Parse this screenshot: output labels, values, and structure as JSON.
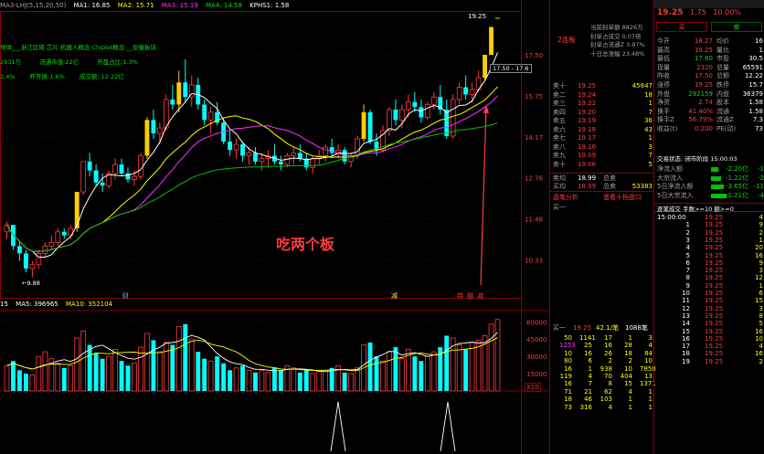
{
  "chart_header": {
    "indicator": "MA3-LHJ(5,15,20,50)",
    "ma1": "MA1: 16.85",
    "ma2": "MA2: 15.71",
    "ma3": "MA3: 15.19",
    "ma4": "MA4: 14.58",
    "kphs": "KPHS1: 1.58"
  },
  "info_lines": {
    "line1": "导体___浙江区域 芯片 机器人概念 Chiplet概念 __安徽板块",
    "line2a": "2931万",
    "line2b": "流通市值:22亿",
    "line2c": "开盘占比:1.3%",
    "line3a": "1.4%",
    "line3b": "昨开换:1.6%",
    "line3c": "成交额: 12.22亿"
  },
  "price_axis": [
    "17.50",
    "15.75",
    "14.17",
    "12.76",
    "11.48",
    "10.33"
  ],
  "top_marker": "19.25",
  "price_label_box": "17.50 - 17.6",
  "low_marker": "←9.88",
  "annotation": "吃两个板",
  "event_marks": [
    "财",
    "减",
    "持",
    "融",
    "减"
  ],
  "volume_header": {
    "vol": "15",
    "ma5": "MA5: 396965",
    "ma10": "MA10: 352104"
  },
  "volume_axis": [
    "60000",
    "45000",
    "30000",
    "15000"
  ],
  "volume_unit": "X10",
  "chart_data": {
    "type": "bar",
    "title": "",
    "xlabel": "",
    "ylabel": "",
    "ylim": [
      9.5,
      19.5
    ],
    "x": [
      0,
      1,
      2,
      3,
      4,
      5,
      6,
      7,
      8,
      9,
      10,
      11,
      12,
      13,
      14,
      15,
      16,
      17,
      18,
      19,
      20,
      21,
      22,
      23,
      24,
      25,
      26,
      27,
      28,
      29,
      30,
      31,
      32,
      33,
      34,
      35,
      36,
      37,
      38,
      39,
      40,
      41,
      42,
      43,
      44,
      45,
      46,
      47,
      48,
      49,
      50,
      51,
      52,
      53,
      54,
      55,
      56,
      57,
      58,
      59,
      60,
      61,
      62,
      63,
      64,
      65,
      66,
      67,
      68,
      69,
      70,
      71,
      72,
      73,
      74,
      75,
      76,
      77,
      78,
      79,
      80,
      81,
      82,
      83,
      84,
      85,
      86,
      87
    ],
    "candles": [
      [
        11.1,
        11.4,
        10.9,
        11.3
      ],
      [
        11.3,
        11.3,
        10.6,
        10.7
      ],
      [
        10.7,
        10.8,
        10.3,
        10.5
      ],
      [
        10.5,
        10.6,
        10.0,
        10.1
      ],
      [
        10.1,
        10.3,
        9.88,
        10.2
      ],
      [
        10.2,
        10.6,
        10.1,
        10.5
      ],
      [
        10.5,
        10.8,
        10.4,
        10.7
      ],
      [
        10.7,
        11.0,
        10.6,
        10.8
      ],
      [
        10.8,
        11.2,
        10.7,
        11.1
      ],
      [
        11.1,
        11.2,
        10.9,
        11.0
      ],
      [
        11.0,
        11.3,
        10.9,
        11.2
      ],
      [
        11.2,
        12.3,
        11.1,
        12.3
      ],
      [
        12.3,
        13.3,
        12.2,
        13.3
      ],
      [
        13.3,
        13.6,
        12.8,
        13.0
      ],
      [
        13.0,
        13.2,
        12.5,
        12.6
      ],
      [
        12.6,
        12.9,
        12.3,
        12.5
      ],
      [
        12.5,
        13.0,
        12.4,
        12.9
      ],
      [
        12.9,
        13.4,
        12.7,
        13.2
      ],
      [
        13.2,
        13.4,
        12.8,
        12.9
      ],
      [
        12.9,
        13.1,
        12.6,
        12.7
      ],
      [
        12.7,
        13.0,
        12.5,
        12.8
      ],
      [
        12.8,
        13.6,
        12.7,
        13.5
      ],
      [
        13.5,
        14.9,
        13.4,
        14.8
      ],
      [
        14.8,
        15.2,
        14.1,
        14.3
      ],
      [
        14.3,
        14.7,
        13.9,
        14.5
      ],
      [
        14.5,
        15.8,
        14.4,
        15.6
      ],
      [
        15.6,
        16.2,
        15.2,
        15.4
      ],
      [
        15.4,
        16.8,
        15.1,
        16.3
      ],
      [
        16.3,
        17.3,
        15.5,
        15.7
      ],
      [
        15.7,
        16.6,
        15.3,
        16.2
      ],
      [
        16.2,
        16.5,
        15.2,
        15.4
      ],
      [
        15.4,
        15.6,
        14.6,
        14.8
      ],
      [
        14.8,
        15.3,
        14.3,
        15.1
      ],
      [
        15.1,
        15.5,
        14.6,
        14.7
      ],
      [
        14.7,
        14.9,
        13.9,
        14.0
      ],
      [
        14.0,
        14.4,
        13.5,
        13.7
      ],
      [
        13.7,
        14.1,
        13.4,
        13.9
      ],
      [
        13.9,
        14.0,
        13.3,
        13.5
      ],
      [
        13.5,
        13.8,
        13.2,
        13.6
      ],
      [
        13.6,
        13.8,
        13.2,
        13.3
      ],
      [
        13.3,
        13.6,
        13.0,
        13.4
      ],
      [
        13.4,
        13.7,
        13.1,
        13.5
      ],
      [
        13.5,
        13.9,
        13.2,
        13.3
      ],
      [
        13.3,
        13.5,
        13.0,
        13.2
      ],
      [
        13.2,
        13.6,
        13.1,
        13.5
      ],
      [
        13.5,
        13.8,
        13.2,
        13.6
      ],
      [
        13.6,
        13.9,
        13.3,
        13.4
      ],
      [
        13.4,
        13.6,
        13.0,
        13.1
      ],
      [
        13.1,
        13.5,
        12.9,
        13.4
      ],
      [
        13.4,
        13.7,
        13.2,
        13.5
      ],
      [
        13.5,
        13.9,
        13.3,
        13.8
      ],
      [
        13.8,
        14.1,
        13.5,
        13.6
      ],
      [
        13.6,
        13.9,
        13.4,
        13.7
      ],
      [
        13.7,
        13.8,
        13.2,
        13.3
      ],
      [
        13.3,
        13.6,
        13.1,
        13.5
      ],
      [
        13.5,
        14.2,
        13.4,
        14.1
      ],
      [
        14.1,
        15.4,
        14.0,
        15.1
      ],
      [
        15.1,
        15.2,
        13.9,
        14.0
      ],
      [
        14.0,
        14.3,
        13.5,
        13.7
      ],
      [
        13.7,
        14.6,
        13.6,
        14.4
      ],
      [
        14.4,
        15.3,
        14.2,
        15.2
      ],
      [
        15.2,
        15.6,
        14.6,
        14.8
      ],
      [
        14.8,
        15.4,
        14.5,
        15.2
      ],
      [
        15.2,
        15.8,
        14.9,
        15.5
      ],
      [
        15.5,
        15.9,
        15.1,
        15.3
      ],
      [
        15.3,
        15.6,
        14.7,
        14.9
      ],
      [
        14.9,
        15.5,
        14.8,
        15.4
      ],
      [
        15.4,
        15.9,
        15.2,
        15.7
      ],
      [
        15.7,
        16.2,
        15.0,
        15.2
      ],
      [
        15.2,
        15.6,
        14.1,
        14.2
      ],
      [
        14.2,
        15.8,
        14.1,
        15.6
      ],
      [
        15.6,
        16.3,
        15.4,
        16.1
      ],
      [
        16.1,
        16.6,
        15.6,
        15.8
      ],
      [
        15.8,
        16.3,
        15.5,
        16.0
      ],
      [
        16.0,
        16.8,
        15.9,
        16.5
      ],
      [
        16.5,
        17.5,
        16.4,
        17.5
      ],
      [
        17.5,
        18.8,
        17.5,
        18.8
      ],
      [
        19.25,
        19.25,
        19.25,
        19.25
      ]
    ],
    "series": [
      {
        "name": "MA1"
      },
      {
        "name": "MA2"
      },
      {
        "name": "MA3"
      },
      {
        "name": "MA4"
      }
    ],
    "volume": [
      22,
      26,
      18,
      15,
      14,
      30,
      34,
      28,
      24,
      20,
      22,
      46,
      52,
      40,
      33,
      28,
      30,
      36,
      26,
      22,
      24,
      38,
      50,
      44,
      34,
      42,
      40,
      56,
      58,
      45,
      34,
      28,
      26,
      30,
      24,
      18,
      20,
      22,
      18,
      16,
      18,
      16,
      20,
      18,
      22,
      20,
      16,
      18,
      15,
      17,
      18,
      20,
      22,
      16,
      15,
      20,
      40,
      42,
      30,
      26,
      34,
      38,
      28,
      36,
      30,
      26,
      30,
      34,
      38,
      48,
      46,
      40,
      36,
      42,
      44,
      48,
      58,
      62
    ],
    "volume_ylim": [
      0,
      65000
    ]
  },
  "right_header": {
    "title_lines": [
      "当前封单额 8826万",
      "封单占成交 0.07倍",
      "封单占流通Z 3.97%",
      "十日总涨幅 23.48%"
    ],
    "board_tag": "2连板"
  },
  "order_book": {
    "sells": [
      [
        "卖十",
        "19.25",
        "45847"
      ],
      [
        "卖二",
        "19.24",
        "18"
      ],
      [
        "卖三",
        "19.22",
        "1"
      ],
      [
        "卖四",
        "19.20",
        "7"
      ],
      [
        "卖五",
        "19.19",
        "36"
      ],
      [
        "卖六",
        "19.18",
        "43"
      ],
      [
        "卖七",
        "19.17",
        "1"
      ],
      [
        "卖八",
        "19.16",
        "3"
      ],
      [
        "卖九",
        "19.09",
        "7"
      ],
      [
        "卖十",
        "19.06",
        "5"
      ]
    ],
    "buy_avg": [
      "卖均",
      "18.99",
      "总卖",
      ""
    ],
    "buy_avg2": [
      "买均",
      "18.99",
      "总卖",
      "53383"
    ],
    "tabs": [
      "逐笔分析",
      "查看十档盘口"
    ],
    "buy_one": "买一"
  },
  "quote": {
    "price": "19.25",
    "change": "1.75",
    "pct": "10.00%",
    "buy_tab": "买",
    "sell_tab": "卖",
    "rows": [
      [
        "今开",
        "18.27",
        "均价",
        "16"
      ],
      [
        "最高",
        "19.25",
        "量比",
        "1"
      ],
      [
        "最低",
        "17.60",
        "市盈",
        "30.5"
      ],
      [
        "现量",
        "2320",
        "总量",
        "65591"
      ],
      [
        "昨收",
        "17.50",
        "总额",
        "12.22"
      ],
      [
        "涨停",
        "19.25",
        "跌停",
        "15.7"
      ],
      [
        "外盘",
        "292159",
        "内盘",
        "36379"
      ],
      [
        "净资",
        "2.74",
        "股本",
        "1.58"
      ],
      [
        "换手",
        "41.40%",
        "流通",
        "1.58"
      ],
      [
        "换手Z",
        "56.79%",
        "流通Z",
        "7.3"
      ],
      [
        "收益(t)",
        "0.200",
        "PE(动)",
        "73"
      ]
    ],
    "trade_status": "交易状态: 闭市阶段 15:00:03",
    "flows": [
      [
        "净流入额",
        "-2.20亿",
        "-1"
      ],
      [
        "大宗流入",
        "-1.22亿",
        "-2"
      ],
      [
        "5日净流入额",
        "-3.65亿",
        "-11"
      ],
      [
        "5日大宗流入",
        "-1.21亿",
        "-4"
      ]
    ]
  },
  "tick_header": "逐笔成交  手数>=10 额>=0",
  "ticks": [
    [
      "15:00:00",
      "19.25",
      "4"
    ],
    [
      "1",
      "19.25",
      "9"
    ],
    [
      "2",
      "19.25",
      "2"
    ],
    [
      "3",
      "19.25",
      "1"
    ],
    [
      "4",
      "19.25",
      "20"
    ],
    [
      "5",
      "19.25",
      "16"
    ],
    [
      "6",
      "19.25",
      "9"
    ],
    [
      "7",
      "19.25",
      "3"
    ],
    [
      "8",
      "19.25",
      "12"
    ],
    [
      "9",
      "19.25",
      "1"
    ],
    [
      "10",
      "19.25",
      "6"
    ],
    [
      "11",
      "19.25",
      "15"
    ],
    [
      "12",
      "19.25",
      "3"
    ],
    [
      "13",
      "19.25",
      "8"
    ],
    [
      "14",
      "19.25",
      "5"
    ],
    [
      "15",
      "19.25",
      "16"
    ],
    [
      "16",
      "19.25",
      "10"
    ],
    [
      "17",
      "19.25",
      "4"
    ],
    [
      "18",
      "19.25",
      "16"
    ],
    [
      "19",
      "19.25",
      "2"
    ]
  ],
  "bottom_book": {
    "buy_one": "买一",
    "buy_one_price": "19.25",
    "buy_one_vol": "42.1/笔",
    "buy_one_count": "1088笔",
    "grid": [
      [
        "50",
        "1141",
        "17",
        "1",
        "3"
      ],
      [
        "1253",
        "25",
        "16",
        "28",
        "4"
      ],
      [
        "10",
        "16",
        "26",
        "18",
        "84"
      ],
      [
        "80",
        "6",
        "2",
        "2",
        "10"
      ],
      [
        "16",
        "1",
        "938",
        "10",
        "7858"
      ],
      [
        "119",
        "4",
        "70",
        "404",
        "13"
      ],
      [
        "16",
        "7",
        "8",
        "15",
        "1371"
      ],
      [
        "71",
        "21",
        "62",
        "4",
        "1"
      ],
      [
        "18",
        "46",
        "103",
        "1",
        "1"
      ],
      [
        "73",
        "316",
        "4",
        "1",
        "1"
      ]
    ]
  },
  "colors": {
    "up": "#ff3c3c",
    "down": "#00ffff",
    "limit": "#ffcc00",
    "ma1": "#ffffff",
    "ma2": "#ffff00",
    "ma3": "#ff30ff",
    "ma4": "#00c000"
  }
}
